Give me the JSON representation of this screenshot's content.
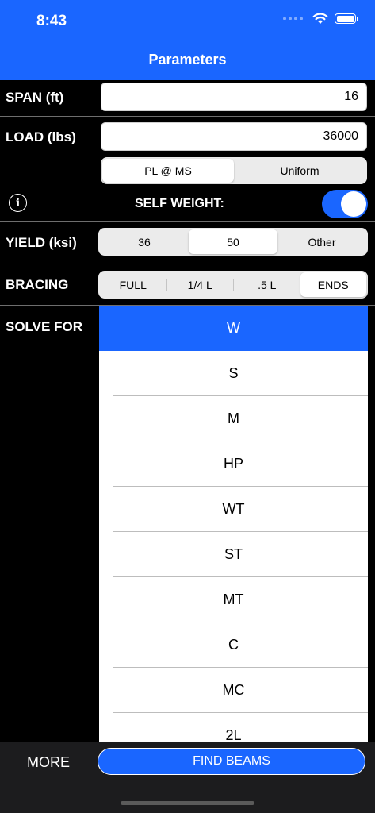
{
  "status": {
    "time": "8:43"
  },
  "header": {
    "title": "Parameters"
  },
  "span": {
    "label": "SPAN (ft)",
    "value": "16"
  },
  "load": {
    "label": "LOAD (lbs)",
    "value": "36000",
    "type_options": [
      "PL @ MS",
      "Uniform"
    ],
    "selected_type": "PL @ MS"
  },
  "self_weight": {
    "label": "SELF WEIGHT:",
    "enabled": true
  },
  "yield": {
    "label": "YIELD (ksi)",
    "options": [
      "36",
      "50",
      "Other"
    ],
    "selected": "50"
  },
  "bracing": {
    "label": "BRACING",
    "options": [
      "FULL",
      "1/4 L",
      ".5 L",
      "ENDS"
    ],
    "selected": "ENDS"
  },
  "solve_for": {
    "label": "SOLVE FOR",
    "options": [
      "W",
      "S",
      "M",
      "HP",
      "WT",
      "ST",
      "MT",
      "C",
      "MC",
      "2L"
    ],
    "selected": "W"
  },
  "bottom": {
    "more_label": "MORE",
    "find_label": "FIND BEAMS"
  },
  "colors": {
    "accent": "#1a66ff",
    "background": "#000000"
  }
}
